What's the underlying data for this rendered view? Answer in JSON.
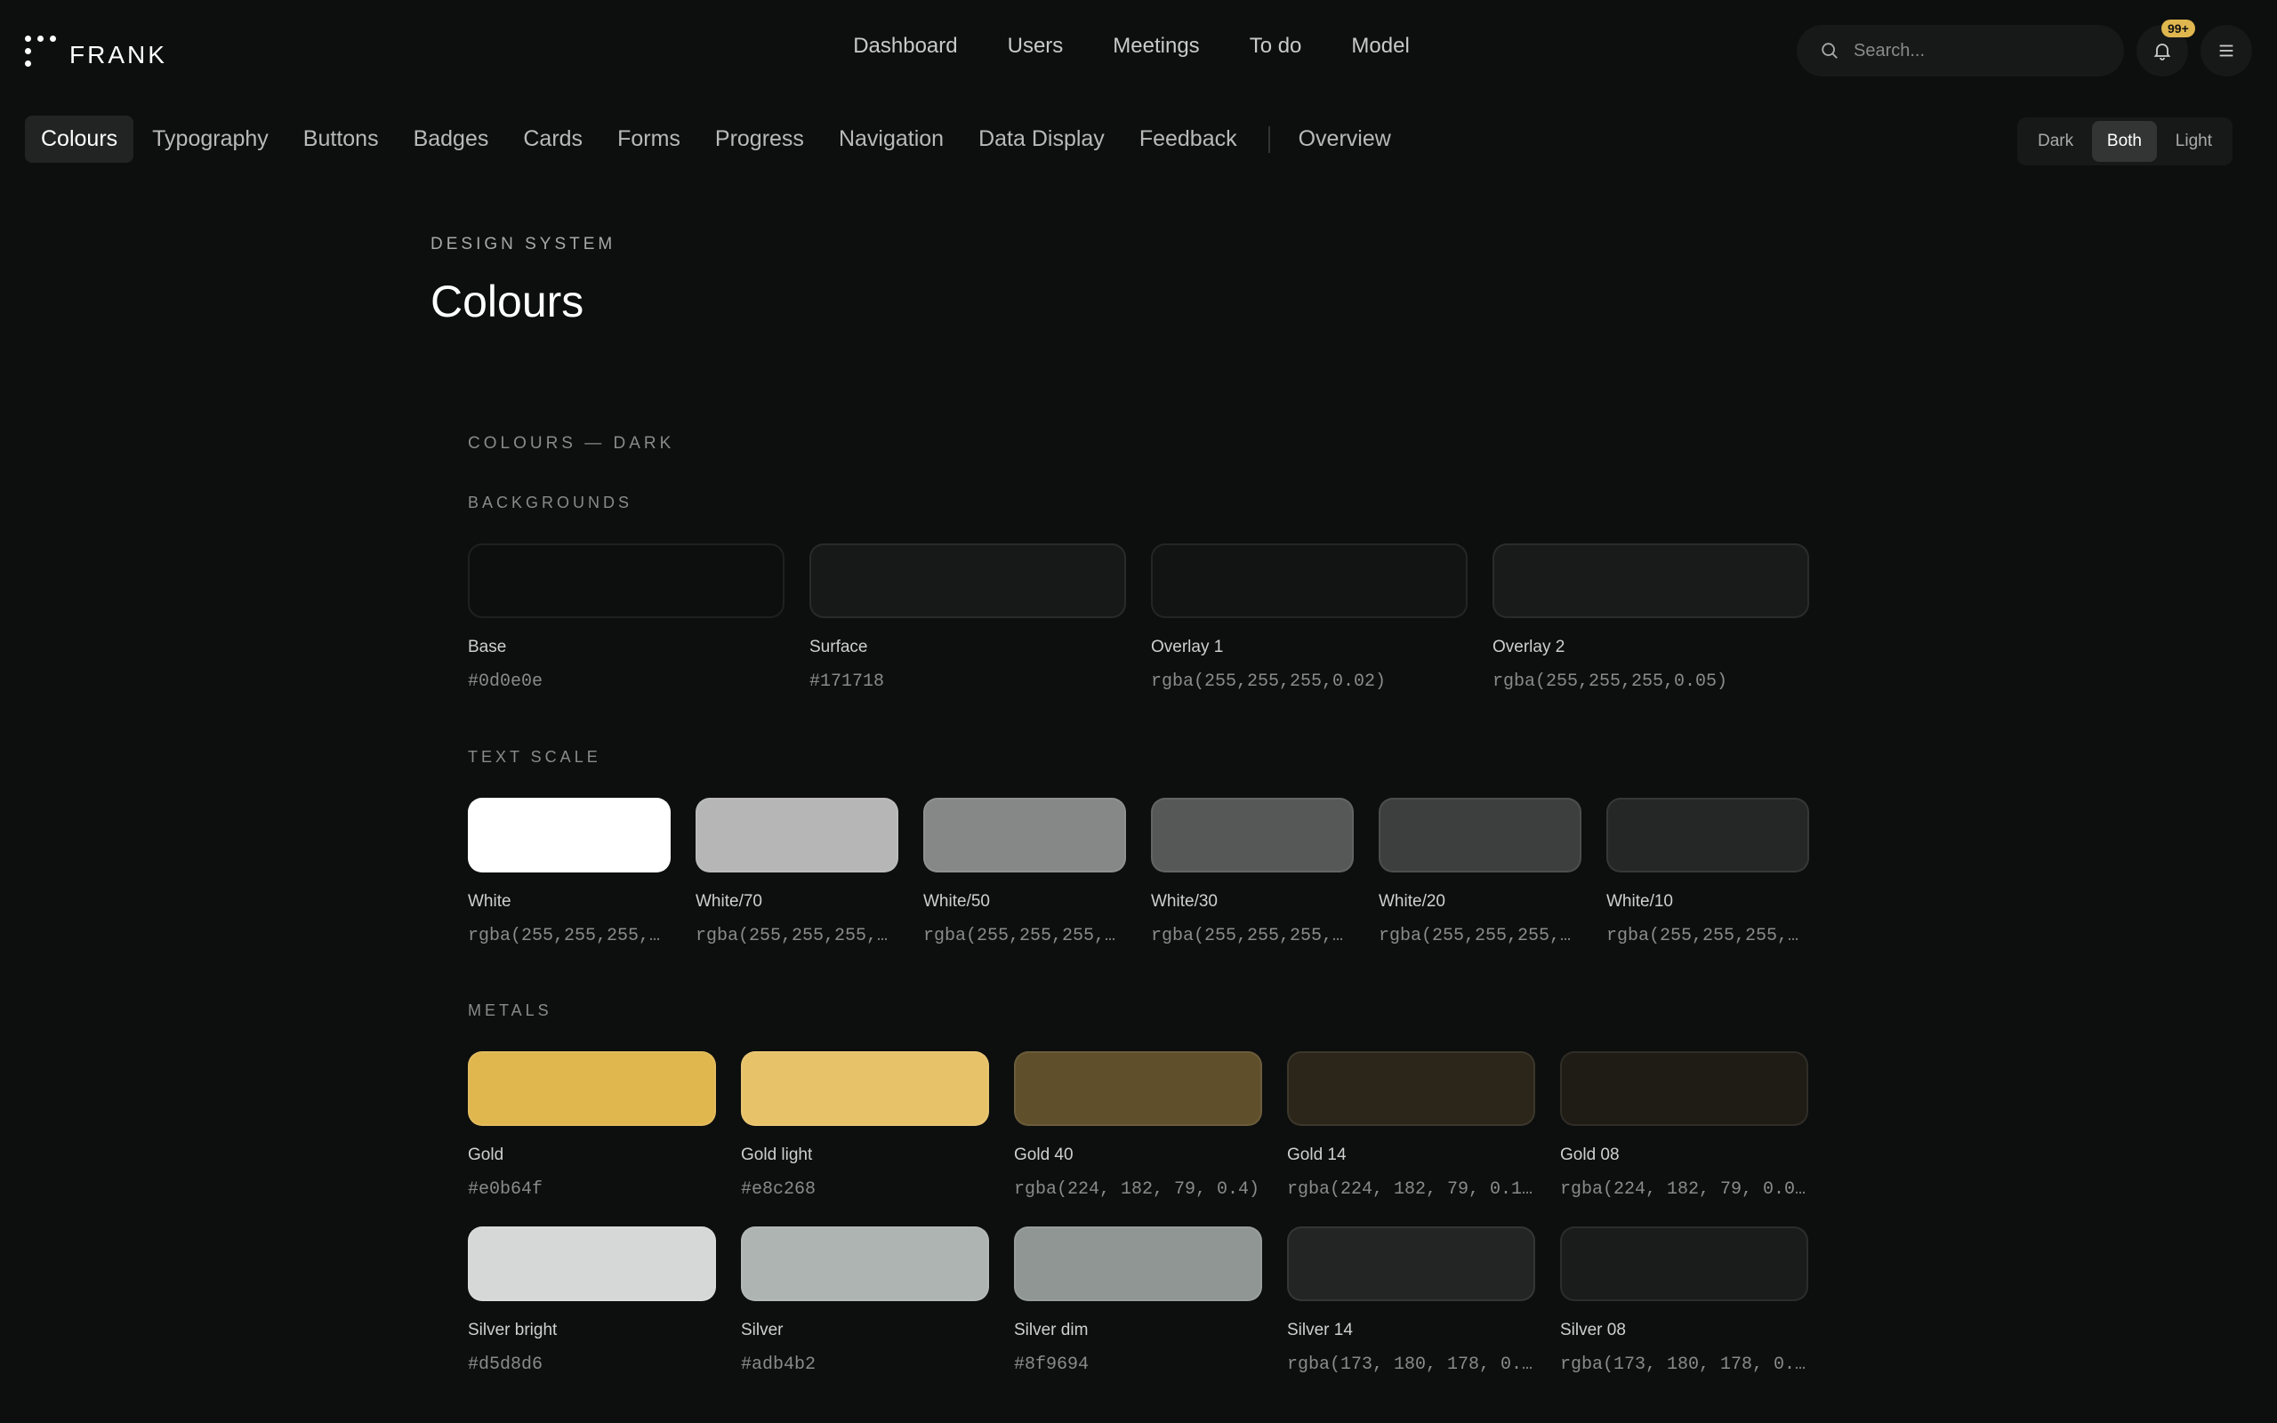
{
  "app": {
    "brand": "FRANK"
  },
  "nav": [
    "Dashboard",
    "Users",
    "Meetings",
    "To do",
    "Model"
  ],
  "search": {
    "placeholder": "Search..."
  },
  "notifications": {
    "badge": "99+"
  },
  "subnav": {
    "tabs": [
      "Colours",
      "Typography",
      "Buttons",
      "Badges",
      "Cards",
      "Forms",
      "Progress",
      "Navigation",
      "Data Display",
      "Feedback"
    ],
    "extra": "Overview",
    "active": "Colours"
  },
  "theme": {
    "options": [
      "Dark",
      "Both",
      "Light"
    ],
    "active": "Both"
  },
  "page": {
    "eyebrow": "DESIGN SYSTEM",
    "title": "Colours"
  },
  "section": {
    "title": "COLOURS — DARK"
  },
  "groups": {
    "backgrounds": {
      "title": "BACKGROUNDS",
      "items": [
        {
          "name": "Base",
          "value": "#0d0e0e",
          "color": "#0d0e0e"
        },
        {
          "name": "Surface",
          "value": "#171718",
          "color": "#171818"
        },
        {
          "name": "Overlay 1",
          "value": "rgba(255,255,255,0.02)",
          "color": "#121313"
        },
        {
          "name": "Overlay 2",
          "value": "rgba(255,255,255,0.05)",
          "color": "#191a1a"
        }
      ]
    },
    "text_scale": {
      "title": "TEXT SCALE",
      "items": [
        {
          "name": "White",
          "value": "rgba(255,255,255,1...",
          "color": "#ffffff"
        },
        {
          "name": "White/70",
          "value": "rgba(255,255,255,0...",
          "color": "#b6b6b6"
        },
        {
          "name": "White/50",
          "value": "rgba(255,255,255,0...",
          "color": "#868787"
        },
        {
          "name": "White/30",
          "value": "rgba(255,255,255,0...",
          "color": "#565757"
        },
        {
          "name": "White/20",
          "value": "rgba(255,255,255,0...",
          "color": "#3d3e3e"
        },
        {
          "name": "White/10",
          "value": "rgba(255,255,255,0...",
          "color": "#252626"
        }
      ]
    },
    "metals_gold": {
      "title": "METALS",
      "items": [
        {
          "name": "Gold",
          "value": "#e0b64f",
          "color": "#e0b64f"
        },
        {
          "name": "Gold light",
          "value": "#e8c268",
          "color": "#e8c268"
        },
        {
          "name": "Gold 40",
          "value": "rgba(224, 182, 79, 0.4)",
          "color": "#5f4f2b"
        },
        {
          "name": "Gold 14",
          "value": "rgba(224, 182, 79, 0.1...",
          "color": "#2b2619"
        },
        {
          "name": "Gold 08",
          "value": "rgba(224, 182, 79, 0.0...",
          "color": "#1e1c14"
        }
      ]
    },
    "metals_silver": {
      "items": [
        {
          "name": "Silver bright",
          "value": "#d5d8d6",
          "color": "#d5d8d6"
        },
        {
          "name": "Silver",
          "value": "#adb4b2",
          "color": "#adb4b2"
        },
        {
          "name": "Silver dim",
          "value": "#8f9694",
          "color": "#8f9694"
        },
        {
          "name": "Silver 14",
          "value": "rgba(173, 180, 178, 0...",
          "color": "#232525"
        },
        {
          "name": "Silver 08",
          "value": "rgba(173, 180, 178, 0...",
          "color": "#1a1b1b"
        }
      ]
    }
  }
}
